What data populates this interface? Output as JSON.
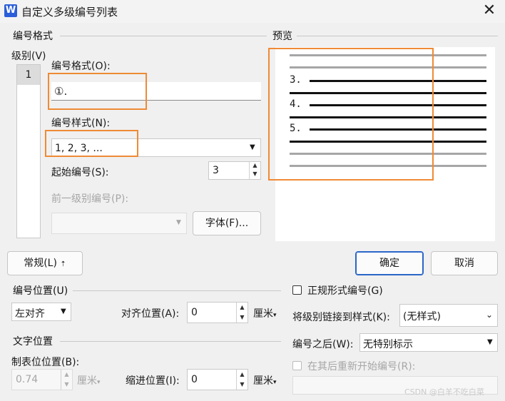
{
  "window": {
    "title": "自定义多级编号列表",
    "app_icon": "W",
    "close_glyph": "✕"
  },
  "number_format_group": {
    "title": "编号格式",
    "level_label": "级别(V)",
    "levels": [
      "1"
    ],
    "format_label": "编号格式(O):",
    "format_value": "①.",
    "style_label": "编号样式(N):",
    "style_value": "1, 2, 3, ...",
    "start_label": "起始编号(S):",
    "start_value": "3",
    "prev_level_label": "前一级别编号(P):",
    "font_button": "字体(F)..."
  },
  "preview": {
    "title": "预览",
    "numbers": [
      "3.",
      "4.",
      "5."
    ]
  },
  "buttons": {
    "general": "常规(L)",
    "general_arrow": "⇡",
    "ok": "确定",
    "cancel": "取消"
  },
  "number_position": {
    "title": "编号位置(U)",
    "align_value": "左对齐",
    "align_pos_label": "对齐位置(A):",
    "align_pos_value": "0",
    "unit": "厘米"
  },
  "text_position": {
    "title": "文字位置",
    "tab_label": "制表位位置(B):",
    "tab_value": "0.74",
    "tab_unit": "厘米",
    "indent_label": "缩进位置(I):",
    "indent_value": "0",
    "indent_unit": "厘米"
  },
  "right_options": {
    "legal_label": "正规形式编号(G)",
    "link_label": "将级别链接到样式(K):",
    "link_value": "(无样式)",
    "after_label": "编号之后(W):",
    "after_value": "无特别标示",
    "restart_label": "在其后重新开始编号(R):"
  },
  "watermark": "CSDN @白羊不吃白菜",
  "colors": {
    "highlight": "#ef8a35",
    "accent": "#2a66c8"
  }
}
